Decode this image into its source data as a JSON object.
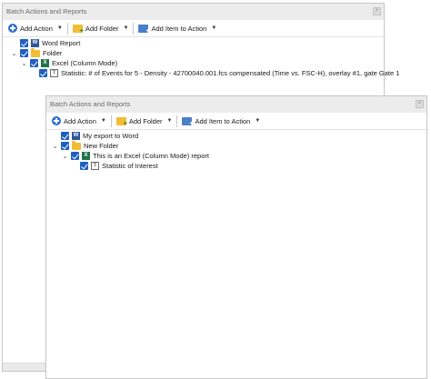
{
  "back_panel": {
    "title": "Batch Actions and Reports",
    "toolbar": {
      "add_action": "Add Action",
      "add_folder": "Add Folder",
      "add_item": "Add Item to Action"
    },
    "tree": [
      {
        "label": "Word Report",
        "icon": "word-icon"
      },
      {
        "label": "Folder",
        "icon": "folder-icon"
      },
      {
        "label": "Excel (Column Mode)",
        "icon": "excel-icon"
      },
      {
        "label": "Statistic: # of Events for 5 - Density - 42700040.001.fcs compensated (Time vs. FSC-H), overlay #1, gate Gate 1",
        "icon": "statistic-icon"
      }
    ]
  },
  "front_panel": {
    "title": "Batch Actions and Reports",
    "toolbar": {
      "add_action": "Add Action",
      "add_folder": "Add Folder",
      "add_item": "Add Item to Action"
    },
    "tree": [
      {
        "label": "My export to Word",
        "icon": "word-icon"
      },
      {
        "label": "New Folder",
        "icon": "folder-icon"
      },
      {
        "label": "This is an Excel (Column Mode) report",
        "icon": "excel-icon"
      },
      {
        "label": "Statistic of Interest",
        "icon": "statistic-icon"
      }
    ]
  },
  "colors": {
    "checkbox": "#1f5fbf",
    "folder": "#f2bd35",
    "word": "#2b5797",
    "excel": "#217346"
  }
}
